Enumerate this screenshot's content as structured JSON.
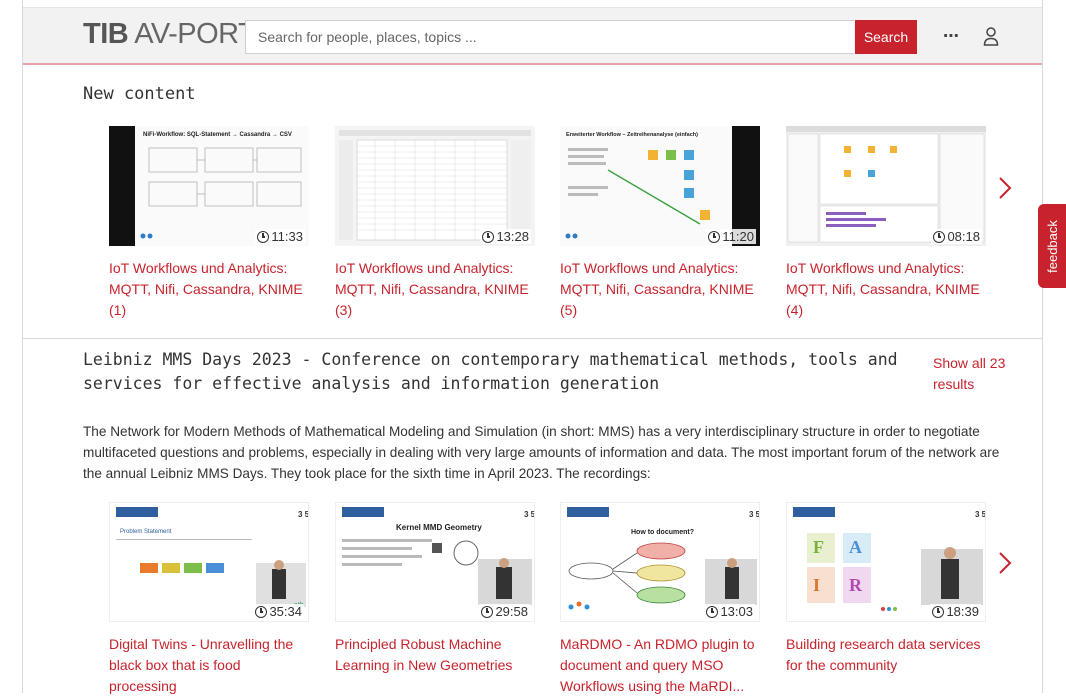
{
  "header": {
    "logo_tib": "TIB",
    "logo_rest": "AV-PORTAL",
    "search_placeholder": "Search for people, places, topics ...",
    "search_button": "Search",
    "more_label": "⋯"
  },
  "new_content": {
    "title": "New content",
    "cards": [
      {
        "title": "IoT Workflows und Analytics: MQTT, Nifi, Cassandra, KNIME (1)",
        "duration": "11:33",
        "slide_heading": "NiFi-Workflow: SQL-Statement → Cassandra → CSV"
      },
      {
        "title": "IoT Workflows und Analytics: MQTT, Nifi, Cassandra, KNIME (3)",
        "duration": "13:28",
        "slide_heading": ""
      },
      {
        "title": "IoT Workflows und Analytics: MQTT, Nifi, Cassandra, KNIME (5)",
        "duration": "11:20",
        "slide_heading": "Erweiterter Workflow – Zeitreihenanalyse (einfach)"
      },
      {
        "title": "IoT Workflows und Analytics: MQTT, Nifi, Cassandra, KNIME (4)",
        "duration": "08:18",
        "slide_heading": ""
      }
    ]
  },
  "collection": {
    "title": "Leibniz MMS Days 2023 - Conference on contemporary mathematical methods, tools and services for effective analysis and information generation",
    "show_all": "Show all 23 results",
    "description": "The Network for Modern Methods of Mathematical Modeling and Simulation (in short: MMS) has a very interdisciplinary structure in order to negotiate multifaceted questions and problems, especially in dealing with very large amounts of information and data. The most important forum of the network are the annual Leibniz MMS Days. They took place for the sixth time in April 2023. The recordings:",
    "cards": [
      {
        "title": "Digital Twins - Unravelling the black box that is food processing",
        "duration": "35:34",
        "slide_heading": "Problem Statement"
      },
      {
        "title": "Principled Robust Machine Learning in New Geometries",
        "duration": "29:58",
        "slide_heading": "Kernel MMD Geometry"
      },
      {
        "title": "MaRDMO - An RDMO plugin to document and query MSO Workflows using the MaRDI...",
        "duration": "13:03",
        "slide_heading": "How to document?"
      },
      {
        "title": "Building research data services for the community",
        "duration": "18:39",
        "slide_heading": ""
      }
    ]
  },
  "feedback_label": "feedback",
  "colors": {
    "accent": "#c8232c",
    "header_bg": "#f2f2f2",
    "text": "#333333"
  }
}
